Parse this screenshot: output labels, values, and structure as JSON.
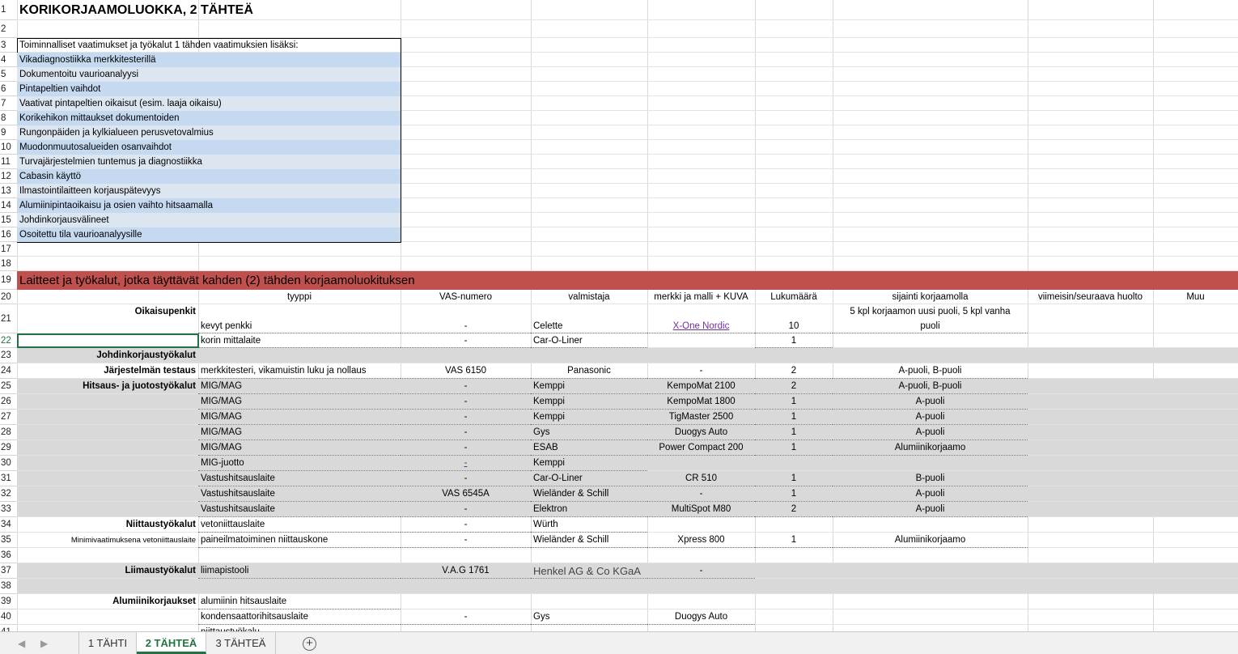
{
  "sheet": {
    "title": "KORIKORJAAMOLUOKKA, 2 TÄHTEÄ",
    "requirements_header": "Toiminnalliset vaatimukset ja työkalut 1 tähden vaatimuksien lisäksi:",
    "requirements": [
      "Vikadiagnostiikka merkkitesterillä",
      "Dokumentoitu vaurioanalyysi",
      "Pintapeltien vaihdot",
      "Vaativat pintapeltien oikaisut (esim. laaja oikaisu)",
      "Korikehikon mittaukset dokumentoiden",
      "Rungonpäiden ja kylkialueen perusvetovalmius",
      "Muodonmuutosalueiden osanvaihdot",
      "Turvajärjestelmien tuntemus ja diagnostiikka",
      "Cabasin käyttö",
      "Ilmastointilaitteen korjauspätevyys",
      "Alumiinipintaoikaisu ja osien vaihto hitsaamalla",
      "Johdinkorjausvälineet",
      "Osoitettu tila vaurioanalyysille"
    ],
    "band_title": "Laitteet ja työkalut, jotka täyttävät kahden (2) tähden korjaamoluokituksen",
    "columns": [
      "tyyppi",
      "VAS-numero",
      "valmistaja",
      "merkki ja malli + KUVA",
      "Lukumäärä",
      "sijainti korjaamolla",
      "viimeisin/seuraava huolto",
      "Muu"
    ],
    "row_numbers": [
      "1",
      "2",
      "3",
      "4",
      "5",
      "6",
      "7",
      "8",
      "9",
      "10",
      "11",
      "12",
      "13",
      "14",
      "15",
      "16",
      "17",
      "18",
      "19",
      "20",
      "21",
      "22",
      "23",
      "24",
      "25",
      "26",
      "27",
      "28",
      "29",
      "30",
      "31",
      "32",
      "33",
      "34",
      "35",
      "36",
      "37",
      "38",
      "39",
      "40",
      "41"
    ],
    "categories": {
      "oikaisu": "Oikaisupenkit",
      "johdin": "Johdinkorjaustyökalut",
      "jarj": "Järjestelmän testaus",
      "hitsaus": "Hitsaus- ja juotostyökalut",
      "niitt": "Niittaustyökalut",
      "niitt_note": "Minimivaatimuksena vetoniittauslaite",
      "liima": "Liimaustyökalut",
      "alu": "Alumiinikorjaukset"
    },
    "rows": {
      "r21": {
        "tyyppi": "kevyt penkki",
        "vas": "-",
        "valmistaja": "Celette",
        "malli": "X-One Nordic",
        "lkm": "10",
        "sijainti1": "5 kpl korjaamon uusi puoli, 5 kpl vanha",
        "sijainti2": "puoli"
      },
      "r22": {
        "tyyppi": "korin mittalaite",
        "vas": "-",
        "valmistaja": "Car-O-Liner",
        "lkm": "1"
      },
      "r24": {
        "tyyppi": "merkkitesteri, vikamuistin luku ja nollaus",
        "vas": "VAS 6150",
        "valmistaja": "Panasonic",
        "malli": "-",
        "lkm": "2",
        "sijainti": "A-puoli, B-puoli"
      },
      "r25": {
        "tyyppi": "MIG/MAG",
        "vas": "-",
        "valmistaja": "Kemppi",
        "malli": "KempoMat 2100",
        "lkm": "2",
        "sijainti": "A-puoli, B-puoli"
      },
      "r26": {
        "tyyppi": "MIG/MAG",
        "vas": "-",
        "valmistaja": "Kemppi",
        "malli": "KempoMat 1800",
        "lkm": "1",
        "sijainti": "A-puoli"
      },
      "r27": {
        "tyyppi": "MIG/MAG",
        "vas": "-",
        "valmistaja": "Kemppi",
        "malli": "TigMaster 2500",
        "lkm": "1",
        "sijainti": "A-puoli"
      },
      "r28": {
        "tyyppi": "MIG/MAG",
        "vas": "-",
        "valmistaja": "Gys",
        "malli": "Duogys Auto",
        "lkm": "1",
        "sijainti": "A-puoli"
      },
      "r29": {
        "tyyppi": "MIG/MAG",
        "vas": "-",
        "valmistaja": "ESAB",
        "malli": "Power Compact 200",
        "lkm": "1",
        "sijainti": "Alumiinikorjaamo"
      },
      "r30": {
        "tyyppi": "MIG-juotto",
        "vas": "-",
        "valmistaja": "Kemppi"
      },
      "r31": {
        "tyyppi": "Vastushitsauslaite",
        "vas": "-",
        "valmistaja": "Car-O-Liner",
        "malli": "CR 510",
        "lkm": "1",
        "sijainti": "B-puoli"
      },
      "r32": {
        "tyyppi": "Vastushitsauslaite",
        "vas": "VAS 6545A",
        "valmistaja": "Wieländer & Schill",
        "malli": "-",
        "lkm": "1",
        "sijainti": "A-puoli"
      },
      "r33": {
        "tyyppi": "Vastushitsauslaite",
        "vas": "-",
        "valmistaja": "Elektron",
        "malli": "MultiSpot M80",
        "lkm": "2",
        "sijainti": "A-puoli"
      },
      "r34": {
        "tyyppi": "vetoniittauslaite",
        "vas": "-",
        "valmistaja": "Würth"
      },
      "r35": {
        "tyyppi": "paineilmatoiminen niittauskone",
        "vas": "-",
        "valmistaja": "Wieländer & Schill",
        "malli": "Xpress 800",
        "lkm": "1",
        "sijainti": "Alumiinikorjaamo"
      },
      "r37": {
        "tyyppi": "liimapistooli",
        "vas": "V.A.G 1761",
        "valmistaja": "Henkel AG & Co KGaA",
        "malli": "-"
      },
      "r39": {
        "tyyppi": "alumiinin hitsauslaite"
      },
      "r40": {
        "tyyppi": "kondensaattorihitsauslaite",
        "vas": "-",
        "valmistaja": "Gys",
        "malli": "Duogys Auto"
      },
      "r41": {
        "tyyppi": "niittaustyökalu"
      }
    }
  },
  "tabs": [
    "1 TÄHTI",
    "2 TÄHTEÄ",
    "3 TÄHTEÄ"
  ],
  "active_tab": "2 TÄHTEÄ",
  "colors": {
    "band": "#c0504d",
    "req_light": "#dce6f1",
    "req_dark": "#c5d9f1",
    "accent": "#217346",
    "grey_fill": "#d9d9d9"
  }
}
